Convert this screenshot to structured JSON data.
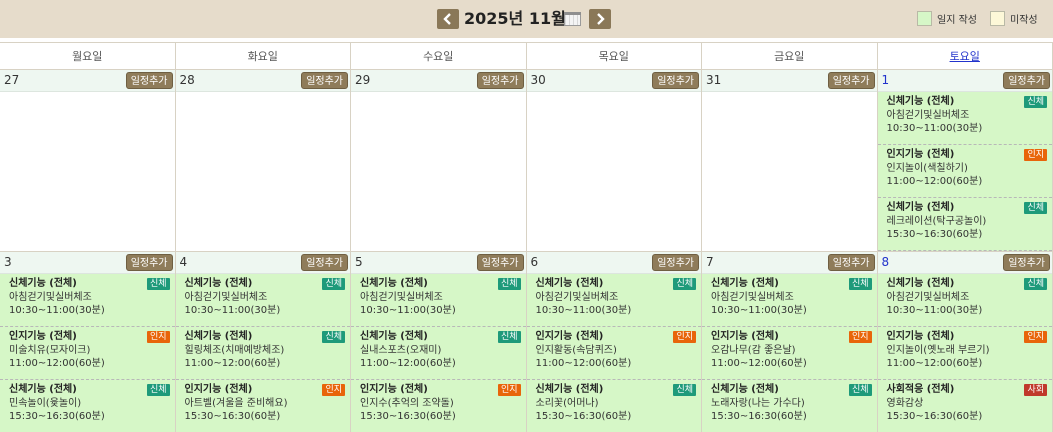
{
  "header": {
    "title": "2025년 11월",
    "legend": [
      {
        "label": "일지 작성",
        "color": "#d6f7c7"
      },
      {
        "label": "미작성",
        "color": "#fdf8d8"
      }
    ],
    "accent_color": "#8f7c5a"
  },
  "weekdays": [
    "월요일",
    "화요일",
    "수요일",
    "목요일",
    "금요일",
    "토요일"
  ],
  "add_label": "일정추가",
  "weeks": [
    {
      "days": [
        {
          "num": "27",
          "events": []
        },
        {
          "num": "28",
          "events": []
        },
        {
          "num": "29",
          "events": []
        },
        {
          "num": "30",
          "events": []
        },
        {
          "num": "31",
          "events": []
        },
        {
          "num": "1",
          "events": [
            {
              "title": "신체기능 (전체)",
              "name": "아침걷기및실버체조",
              "time": "10:30~11:00(30분)",
              "badge": "신체",
              "type": "body"
            },
            {
              "title": "인지기능 (전체)",
              "name": "인지놀이(색칠하기)",
              "time": "11:00~12:00(60분)",
              "badge": "인지",
              "type": "cog"
            },
            {
              "title": "신체기능 (전체)",
              "name": "레크레이션(탁구공놀이)",
              "time": "15:30~16:30(60분)",
              "badge": "신체",
              "type": "body"
            }
          ]
        }
      ]
    },
    {
      "days": [
        {
          "num": "3",
          "events": [
            {
              "title": "신체기능 (전체)",
              "name": "아침걷기및실버체조",
              "time": "10:30~11:00(30분)",
              "badge": "신체",
              "type": "body"
            },
            {
              "title": "인지기능 (전체)",
              "name": "미술치유(모자이크)",
              "time": "11:00~12:00(60분)",
              "badge": "인지",
              "type": "cog"
            },
            {
              "title": "신체기능 (전체)",
              "name": "민속놀이(윷놀이)",
              "time": "15:30~16:30(60분)",
              "badge": "신체",
              "type": "body"
            }
          ]
        },
        {
          "num": "4",
          "events": [
            {
              "title": "신체기능 (전체)",
              "name": "아침걷기및실버체조",
              "time": "10:30~11:00(30분)",
              "badge": "신체",
              "type": "body"
            },
            {
              "title": "신체기능 (전체)",
              "name": "힐링체조(치매예방체조)",
              "time": "11:00~12:00(60분)",
              "badge": "신체",
              "type": "body"
            },
            {
              "title": "인지기능 (전체)",
              "name": "아트벨(겨울을 준비해요)",
              "time": "15:30~16:30(60분)",
              "badge": "인지",
              "type": "cog"
            }
          ]
        },
        {
          "num": "5",
          "events": [
            {
              "title": "신체기능 (전체)",
              "name": "아침걷기및실버체조",
              "time": "10:30~11:00(30분)",
              "badge": "신체",
              "type": "body"
            },
            {
              "title": "신체기능 (전체)",
              "name": "실내스포츠(오재미)",
              "time": "11:00~12:00(60분)",
              "badge": "신체",
              "type": "body"
            },
            {
              "title": "인지기능 (전체)",
              "name": "인지수(추억의 조약돌)",
              "time": "15:30~16:30(60분)",
              "badge": "인지",
              "type": "cog"
            }
          ]
        },
        {
          "num": "6",
          "events": [
            {
              "title": "신체기능 (전체)",
              "name": "아침걷기및실버체조",
              "time": "10:30~11:00(30분)",
              "badge": "신체",
              "type": "body"
            },
            {
              "title": "인지기능 (전체)",
              "name": "인지활동(속담퀴즈)",
              "time": "11:00~12:00(60분)",
              "badge": "인지",
              "type": "cog"
            },
            {
              "title": "신체기능 (전체)",
              "name": "소리꽃(어머나)",
              "time": "15:30~16:30(60분)",
              "badge": "신체",
              "type": "body"
            }
          ]
        },
        {
          "num": "7",
          "events": [
            {
              "title": "신체기능 (전체)",
              "name": "아침걷기및실버체조",
              "time": "10:30~11:00(30분)",
              "badge": "신체",
              "type": "body"
            },
            {
              "title": "인지기능 (전체)",
              "name": "오감나무(감 좋은날)",
              "time": "11:00~12:00(60분)",
              "badge": "인지",
              "type": "cog"
            },
            {
              "title": "신체기능 (전체)",
              "name": "노래자랑(나는 가수다)",
              "time": "15:30~16:30(60분)",
              "badge": "신체",
              "type": "body"
            }
          ]
        },
        {
          "num": "8",
          "events": [
            {
              "title": "신체기능 (전체)",
              "name": "아침걷기및실버체조",
              "time": "10:30~11:00(30분)",
              "badge": "신체",
              "type": "body"
            },
            {
              "title": "인지기능 (전체)",
              "name": "인지놀이(옛노래 부르기)",
              "time": "11:00~12:00(60분)",
              "badge": "인지",
              "type": "cog"
            },
            {
              "title": "사회적응 (전체)",
              "name": "영화감상",
              "time": "15:30~16:30(60분)",
              "badge": "사회",
              "type": "soc"
            }
          ]
        }
      ]
    }
  ]
}
